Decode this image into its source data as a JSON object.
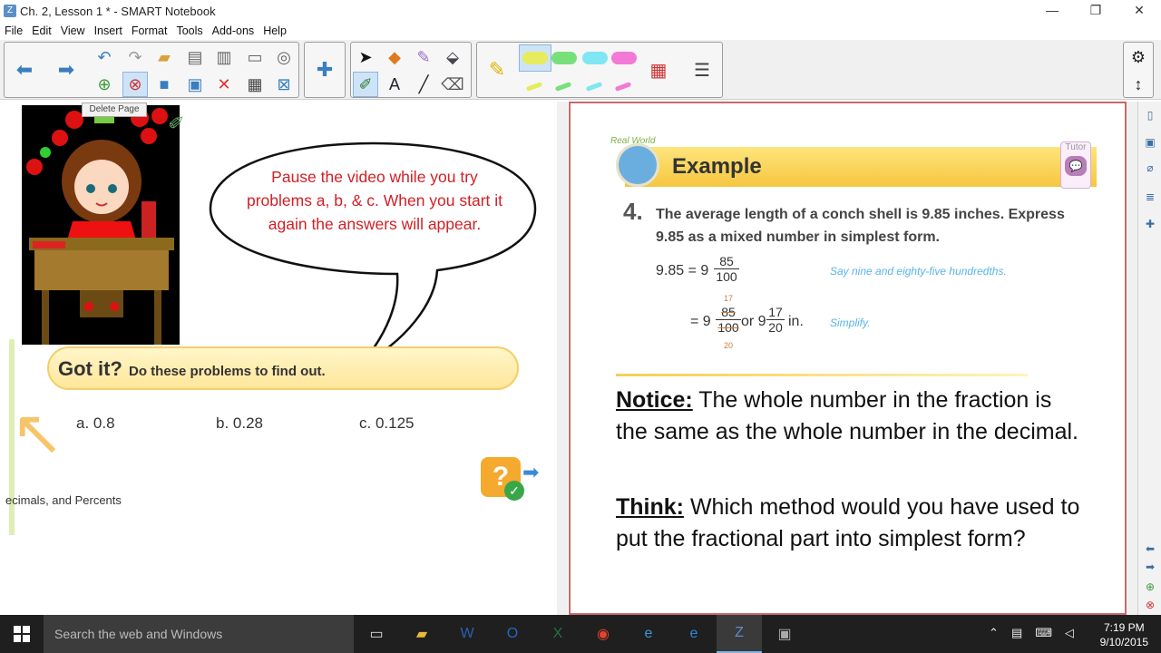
{
  "window": {
    "title": "Ch. 2, Lesson 1 * - SMART Notebook",
    "min": "—",
    "max": "❐",
    "close": "✕"
  },
  "menu": [
    "File",
    "Edit",
    "View",
    "Insert",
    "Format",
    "Tools",
    "Add-ons",
    "Help"
  ],
  "tooltip": "Delete Page",
  "left": {
    "bubble_line1": "Pause the video while you try",
    "bubble_line2": "problems a, b, & c.  When you start it",
    "bubble_line3": "again the answers will appear.",
    "gotit_title": "Got it?",
    "gotit_sub": "Do these problems to find out.",
    "problems": [
      "a. 0.8",
      "b. 0.28",
      "c. 0.125"
    ],
    "footer": "ecimals, and Percents"
  },
  "right": {
    "badge": "Real World",
    "example_title": "Example",
    "tutor": "Tutor",
    "number": "4.",
    "question_line1": "The average length of a conch shell is 9.85 inches. Express",
    "question_line2": "9.85 as a mixed number in simplest form.",
    "eq1_lhs": "9.85 = 9",
    "eq1_num": "85",
    "eq1_den": "100",
    "eq1_note": "Say nine and eighty-five hundredths.",
    "eq2_prefix": "= 9",
    "eq2_top_small": "17",
    "eq2_num": "85",
    "eq2_den": "100",
    "eq2_bottom_small": "20",
    "eq2_or": "or 9",
    "eq2_num2": "17",
    "eq2_den2": "20",
    "eq2_unit": "in.",
    "eq2_note": "Simplify.",
    "notice_label": "Notice:",
    "notice_text": " The whole number in the fraction is the same as the whole number in the decimal.",
    "think_label": "Think:",
    "think_text": " Which method would you have used to put the fractional part into simplest form?"
  },
  "taskbar": {
    "search_placeholder": "Search the web and Windows",
    "time": "7:19 PM",
    "date": "9/10/2015"
  },
  "colors": {
    "accent": "#3a7ec0",
    "bubble_text": "#d21f25",
    "pane_border": "#c76a6a"
  }
}
